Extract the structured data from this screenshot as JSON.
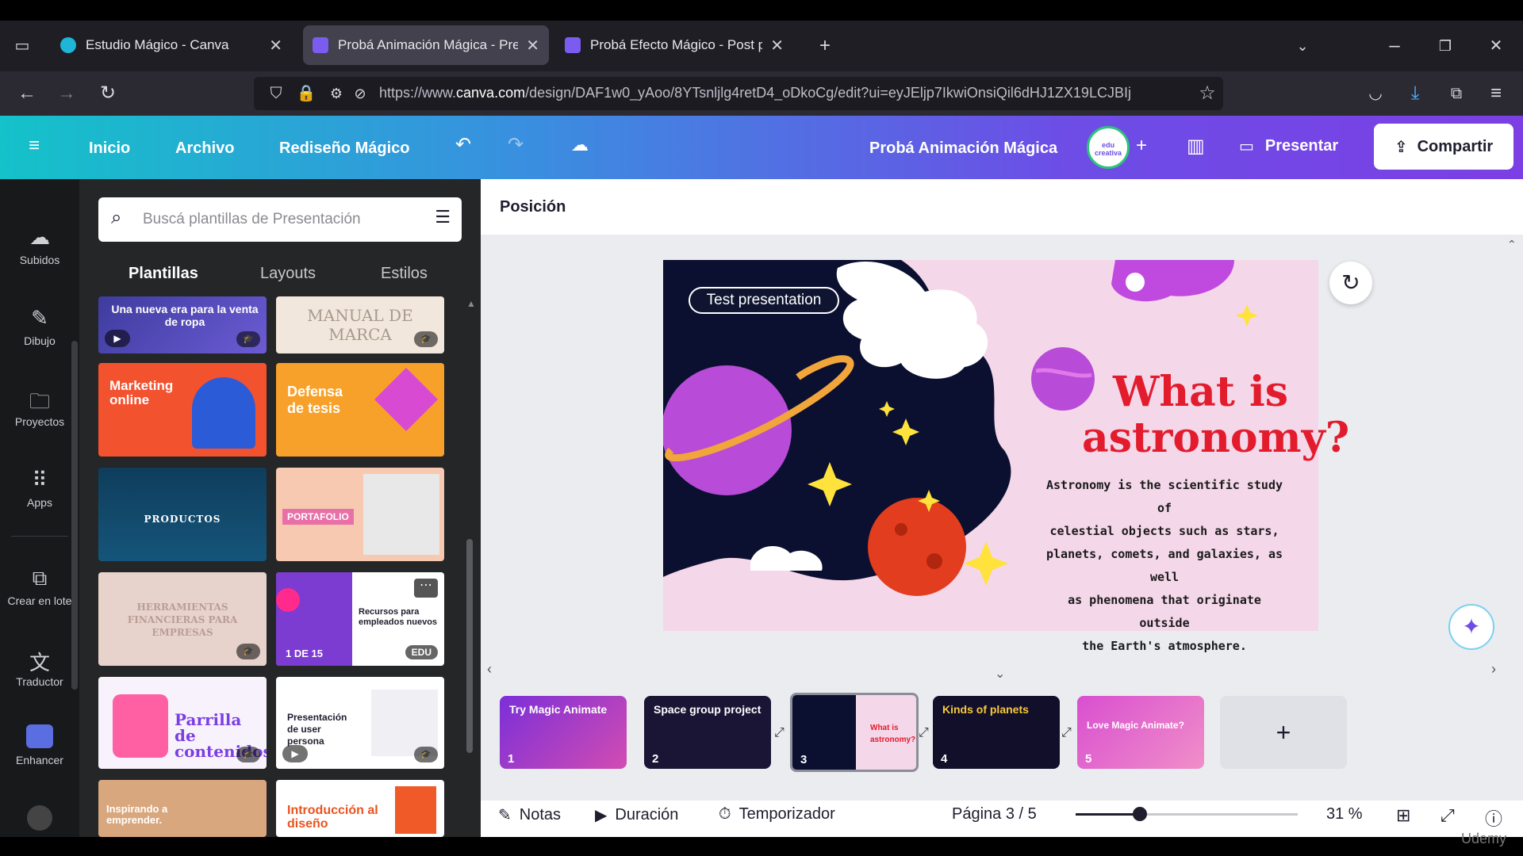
{
  "browser": {
    "tabs": [
      {
        "title": "Estudio Mágico - Canva"
      },
      {
        "title": "Probá Animación Mágica - Pre"
      },
      {
        "title": "Probá Efecto Mágico - Post par"
      }
    ],
    "url_prefix": "https://www.",
    "url_domain": "canva.com",
    "url_rest": "/design/DAF1w0_yAoo/8YTsnljlg4retD4_oDkoCg/edit?ui=eyJEljp7IkwiOnsiQil6dHJ1ZX19LCJBIj"
  },
  "header": {
    "menu": [
      "Inicio",
      "Archivo",
      "Rediseño Mágico"
    ],
    "design_title": "Probá Animación Mágica",
    "present_label": "Presentar",
    "share_label": "Compartir",
    "avatar_text": "edu creativa"
  },
  "rail": {
    "items": [
      "Subidos",
      "Dibujo",
      "Proyectos",
      "Apps",
      "Crear en lote",
      "Traductor",
      "Enhancer"
    ]
  },
  "panel": {
    "search_placeholder": "Buscá plantillas de Presentación",
    "tabs": [
      "Plantillas",
      "Layouts",
      "Estilos"
    ],
    "templates": [
      "Una nueva era para la venta de ropa",
      "MANUAL DE MARCA",
      "Marketing online",
      "Defensa de tesis",
      "PRODUCTOS",
      "PORTAFOLIO",
      "HERRAMIENTAS FINANCIERAS PARA EMPRESAS",
      "Recursos para empleados nuevos",
      "Parrilla de contenidos",
      "Presentación de user persona",
      "Inspirando a emprender.",
      "Introducción al diseño"
    ],
    "counter": "1 DE 15",
    "edu_badge": "EDU"
  },
  "editor": {
    "position_label": "Posición",
    "slide": {
      "pill": "Test presentation",
      "title_line1": "What is",
      "title_line2": "astronomy?",
      "body_lines": [
        "Astronomy is the scientific study of",
        "celestial objects such as stars,",
        "planets, comets, and galaxies, as well",
        "as phenomena that originate outside",
        "the Earth's atmosphere."
      ]
    },
    "pages": [
      {
        "num": "1",
        "label": "Try Magic Animate"
      },
      {
        "num": "2",
        "label": "Space group project"
      },
      {
        "num": "3",
        "label": "What is astronomy?"
      },
      {
        "num": "4",
        "label": "Kinds of planets"
      },
      {
        "num": "5",
        "label": "Love Magic Animate?"
      }
    ]
  },
  "footer": {
    "notes": "Notas",
    "duration": "Duración",
    "timer": "Temporizador",
    "page_indicator": "Página 3 / 5",
    "zoom": "31 %",
    "zoom_level": 0.31
  },
  "watermark": "Udemy",
  "colors": {
    "accent_title": "#e21c2d",
    "slide_bg": "#f4d7e9",
    "header_start": "#14c2c9",
    "header_end": "#7b3fe4"
  }
}
